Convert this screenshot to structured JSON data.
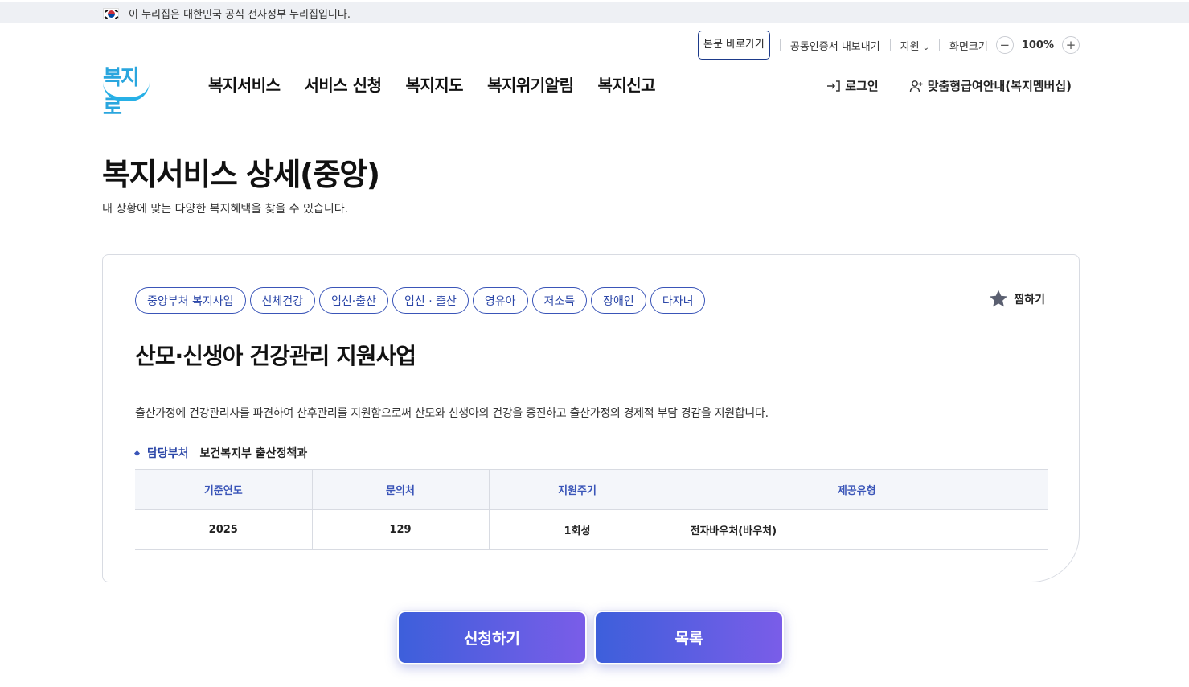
{
  "gov_banner": {
    "text": "이 누리집은 대한민국 공식 전자정부 누리집입니다.",
    "icon": "korea-flag-icon"
  },
  "header": {
    "logo_text": "복지로",
    "utility": {
      "skip_label": "본문 바로가기",
      "cert_label": "공동인증서 내보내기",
      "support_label": "지원",
      "zoom_label": "화면크기",
      "zoom_value": "100%",
      "zoom_out_symbol": "−",
      "zoom_in_symbol": "+"
    },
    "gnb": [
      "복지서비스",
      "서비스 신청",
      "복지지도",
      "복지위기알림",
      "복지신고"
    ],
    "login_label": "로그인",
    "membership_label": "맞춤형급여안내(복지멤버십)"
  },
  "page": {
    "title": "복지서비스 상세(중앙)",
    "subtitle": "내 상황에 맞는 다양한 복지혜택을 찾을 수 있습니다."
  },
  "service": {
    "tags": [
      "중앙부처 복지사업",
      "신체건강",
      "임신·출산",
      "임신 · 출산",
      "영유아",
      "저소득",
      "장애인",
      "다자녀"
    ],
    "favorite_label": "찜하기",
    "title": "산모·신생아 건강관리 지원사업",
    "description": "출산가정에 건강관리사를 파견하여 산후관리를 지원함으로써 산모와 신생아의 건강을 증진하고 출산가정의 경제적 부담 경감을 지원합니다.",
    "dept_label": "담당부처",
    "dept_value": "보건복지부 출산정책과",
    "table": {
      "headers": [
        "기준연도",
        "문의처",
        "지원주기",
        "제공유형"
      ],
      "row": [
        "2025",
        "129",
        "1회성",
        "전자바우처(바우처)"
      ]
    }
  },
  "buttons": {
    "apply_label": "신청하기",
    "list_label": "목록"
  },
  "colors": {
    "accent": "#3a55b8",
    "button_start": "#3d5fdb",
    "button_end": "#7a5de8",
    "logo": "#2aa6de"
  }
}
